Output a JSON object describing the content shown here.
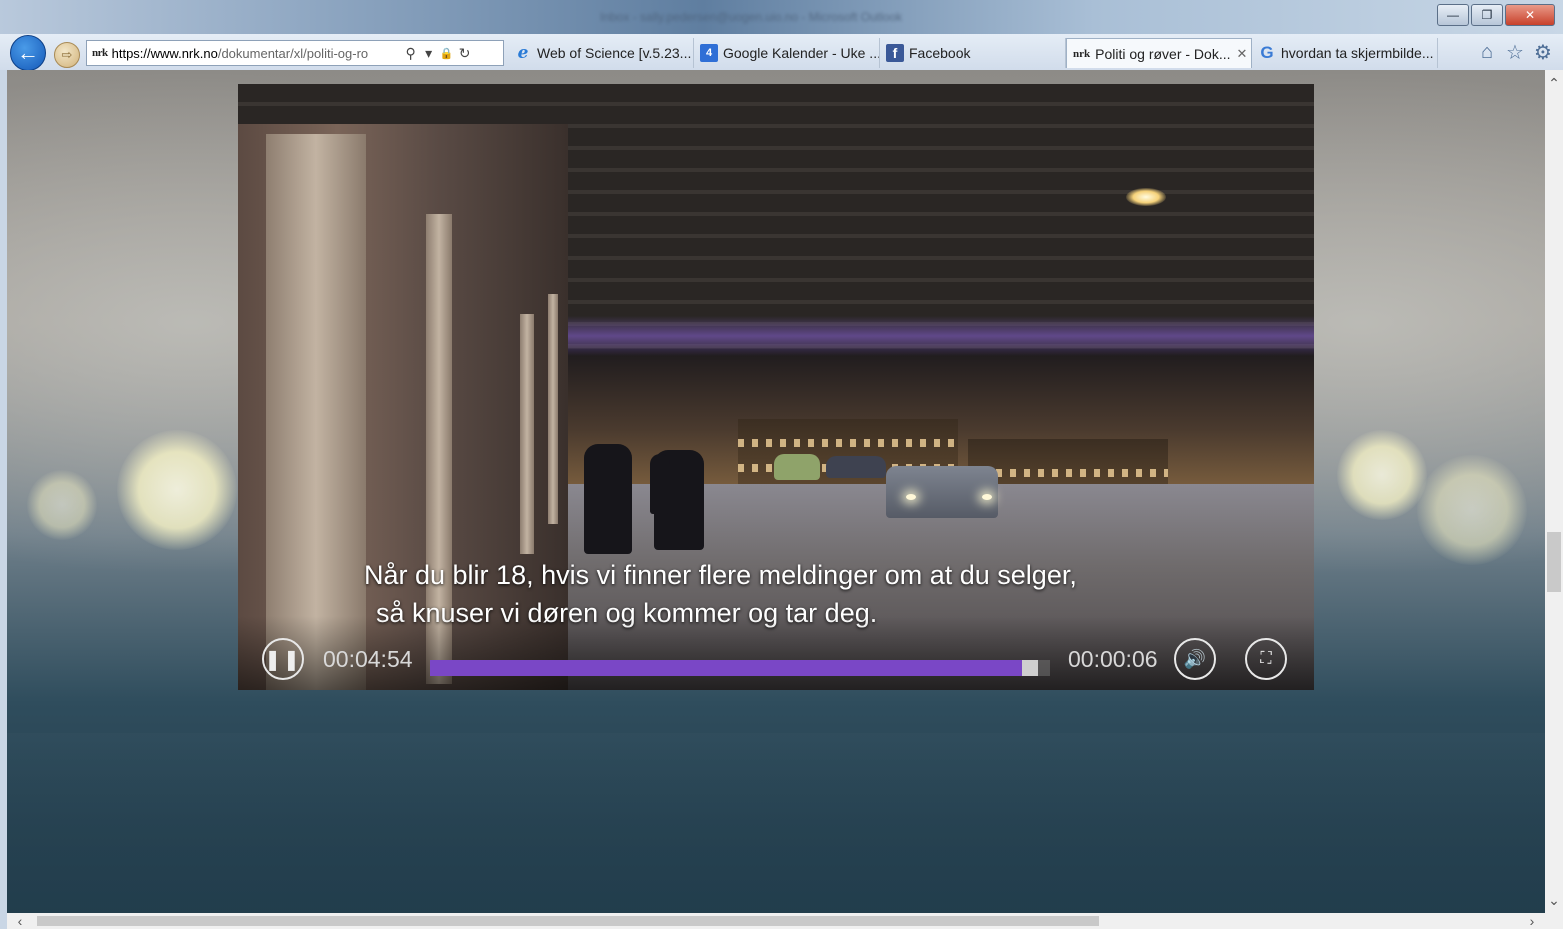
{
  "window": {
    "title": "Inbox - sally.pedersen@uogen.uio.no - Microsoft Outlook",
    "minimize": "—",
    "restore": "❐",
    "close": "✕"
  },
  "nav": {
    "back_icon": "←",
    "forward_icon": "⇨",
    "address": {
      "site_logo": "nrk",
      "url_host": "https://www.nrk.no",
      "url_path": "/dokumentar/xl/politi-og-ro",
      "search_icon": "⚲",
      "dropdown_icon": "▾",
      "lock_icon": "🔒",
      "refresh_icon": "↻"
    },
    "tabs": [
      {
        "label": "Web of Science [v.5.23...",
        "icon": "ie-icon"
      },
      {
        "label": "Google Kalender - Uke ...",
        "icon": "google-calendar-icon",
        "glyph": "4"
      },
      {
        "label": "Facebook",
        "icon": "facebook-icon",
        "glyph": "f"
      },
      {
        "label": "Politi og røver - Dok...",
        "icon": "nrk-icon",
        "glyph": "nrk",
        "active": true,
        "close": "✕"
      },
      {
        "label": "hvordan ta skjermbilde...",
        "icon": "google-icon",
        "glyph": "G"
      }
    ],
    "home_icon": "⌂",
    "favorites_icon": "☆",
    "settings_icon": "⚙"
  },
  "video": {
    "subtitle_line1": "Når du blir 18, hvis vi finner flere meldinger om at du selger,",
    "subtitle_line2": "så knuser vi døren og kommer og tar deg.",
    "time_elapsed": "00:04:54",
    "time_remaining": "00:00:06",
    "progress_fraction": 0.98,
    "pause_icon": "❚❚",
    "volume_icon": "🔊",
    "fullscreen_icon": "⛶",
    "accent_color": "#7a47c6"
  },
  "scrollbars": {
    "up": "⌃",
    "down": "⌄",
    "left": "‹",
    "right": "›"
  }
}
